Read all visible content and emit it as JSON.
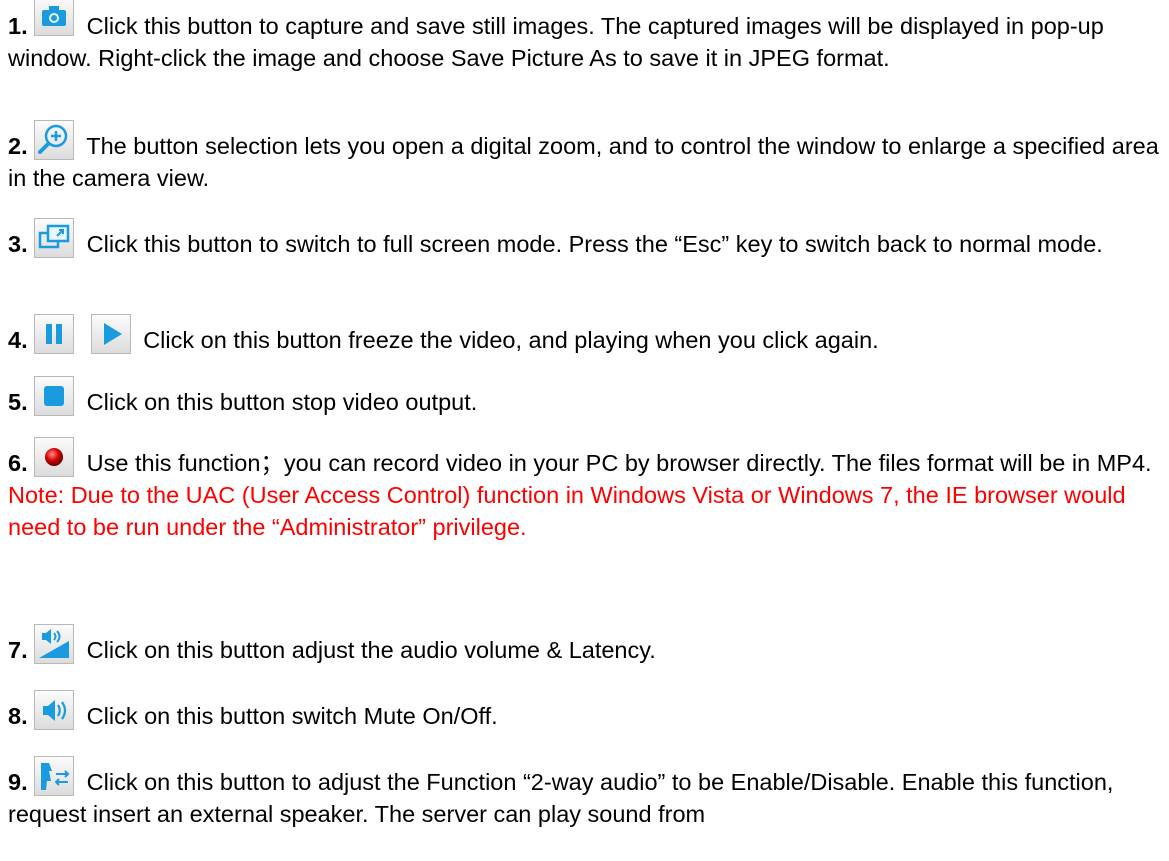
{
  "items": [
    {
      "num": "1.",
      "text": "Click this button to capture and save still images. The captured images will be displayed in pop-up window. Right-click the image and choose Save Picture As to save it in JPEG format.",
      "icon": "camera-icon"
    },
    {
      "num": "2.",
      "text": "The button selection lets you open a digital zoom, and to control the window to enlarge a specified area in the camera view.",
      "icon": "zoom-in-icon"
    },
    {
      "num": "3",
      "text": "Click this button to switch to full screen mode. Press the “Esc” key to switch back to normal mode.",
      "icon": "fullscreen-icon"
    },
    {
      "num": "4.",
      "text": "Click on this button freeze the video, and playing when you click again.",
      "icons": [
        "pause-icon",
        "play-icon"
      ]
    },
    {
      "num": "5.",
      "text": "Click on this button stop video output.",
      "icon": "stop-icon"
    },
    {
      "num": "6.",
      "text": "Use this function；you can record video in your PC by browser directly. The files format will be in MP4.",
      "note": "Note: Due to the UAC (User Access Control) function in Windows Vista or Windows 7, the IE browser would need to be run under the “Administrator” privilege.",
      "icon": "record-icon"
    },
    {
      "num": "7.",
      "text": "Click on this button adjust the audio volume & Latency.",
      "icon": "volume-adjust-icon"
    },
    {
      "num": "8.",
      "text": "Click on this button switch Mute On/Off.",
      "icon": "mute-icon"
    },
    {
      "num": "9.",
      "text": "Click on this button to adjust the Function “2-way audio” to be Enable/Disable. Enable this function, request insert an external speaker. The server can play sound from",
      "icon": "two-way-audio-icon"
    }
  ],
  "colors": {
    "icon_blue": "#1a9be0",
    "note_red": "#ff0000",
    "record_red": "#d40000"
  }
}
